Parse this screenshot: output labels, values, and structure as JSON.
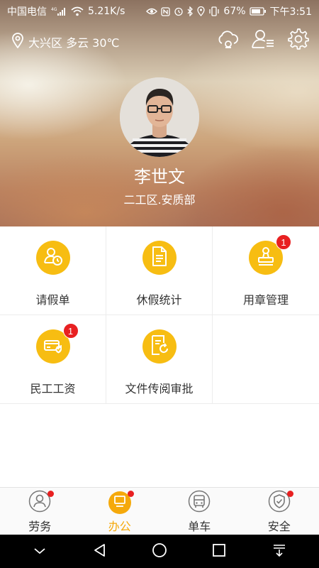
{
  "status_bar": {
    "carrier": "中国电信",
    "network": "4G",
    "speed": "5.21K/s",
    "battery": "67%",
    "time": "下午3:51"
  },
  "header": {
    "location": "大兴区 多云 30℃",
    "user_name": "李世文",
    "department": "二工区.安质部"
  },
  "grid": {
    "items": [
      {
        "label": "请假单",
        "icon": "clock-person-icon",
        "badge": ""
      },
      {
        "label": "休假统计",
        "icon": "document-icon",
        "badge": ""
      },
      {
        "label": "用章管理",
        "icon": "stamp-icon",
        "badge": "1"
      },
      {
        "label": "民工工资",
        "icon": "wallet-card-icon",
        "badge": "1"
      },
      {
        "label": "文件传阅审批",
        "icon": "file-refresh-icon",
        "badge": ""
      }
    ]
  },
  "bottom_nav": {
    "items": [
      {
        "label": "劳务",
        "icon": "person-icon"
      },
      {
        "label": "办公",
        "icon": "monitor-icon"
      },
      {
        "label": "单车",
        "icon": "bus-icon"
      },
      {
        "label": "安全",
        "icon": "shield-check-icon"
      }
    ]
  },
  "colors": {
    "accent": "#f7bd12",
    "active_text": "#f5a90b",
    "badge": "#e82021"
  }
}
